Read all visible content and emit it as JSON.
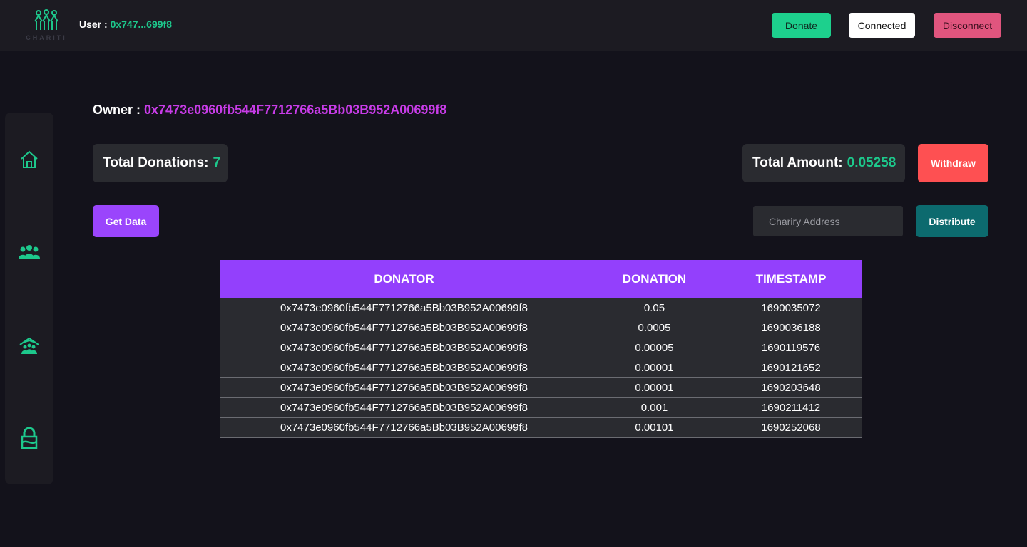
{
  "header": {
    "logo_text": "CHARITI",
    "user_label": "User : ",
    "user_address": "0x747...699f8",
    "buttons": {
      "donate": "Donate",
      "connected": "Connected",
      "disconnect": "Disconnect"
    }
  },
  "sidebar": {
    "items": [
      {
        "icon": "home-icon"
      },
      {
        "icon": "users-icon"
      },
      {
        "icon": "charity-home-icon"
      },
      {
        "icon": "lock-icon"
      }
    ]
  },
  "owner": {
    "label": "Owner : ",
    "address": "0x7473e0960fb544F7712766a5Bb03B952A00699f8"
  },
  "stats": {
    "total_donations_label": "Total Donations:",
    "total_donations_value": "7",
    "total_amount_label": "Total Amount:",
    "total_amount_value": "0.05258"
  },
  "actions": {
    "withdraw": "Withdraw",
    "get_data": "Get Data",
    "charity_placeholder": "Chariry Address",
    "distribute": "Distribute"
  },
  "table": {
    "headers": [
      "DONATOR",
      "DONATION",
      "TIMESTAMP"
    ],
    "rows": [
      [
        "0x7473e0960fb544F7712766a5Bb03B952A00699f8",
        "0.05",
        "1690035072"
      ],
      [
        "0x7473e0960fb544F7712766a5Bb03B952A00699f8",
        "0.0005",
        "1690036188"
      ],
      [
        "0x7473e0960fb544F7712766a5Bb03B952A00699f8",
        "0.00005",
        "1690119576"
      ],
      [
        "0x7473e0960fb544F7712766a5Bb03B952A00699f8",
        "0.00001",
        "1690121652"
      ],
      [
        "0x7473e0960fb544F7712766a5Bb03B952A00699f8",
        "0.00001",
        "1690203648"
      ],
      [
        "0x7473e0960fb544F7712766a5Bb03B952A00699f8",
        "0.001",
        "1690211412"
      ],
      [
        "0x7473e0960fb544F7712766a5Bb03B952A00699f8",
        "0.00101",
        "1690252068"
      ]
    ]
  },
  "colors": {
    "accent_green": "#1dc88c",
    "accent_purple": "#9340fc",
    "owner_address": "#c83ce8",
    "withdraw": "#fe5052",
    "distribute": "#0c6a6e",
    "disconnect": "#e0557e"
  }
}
